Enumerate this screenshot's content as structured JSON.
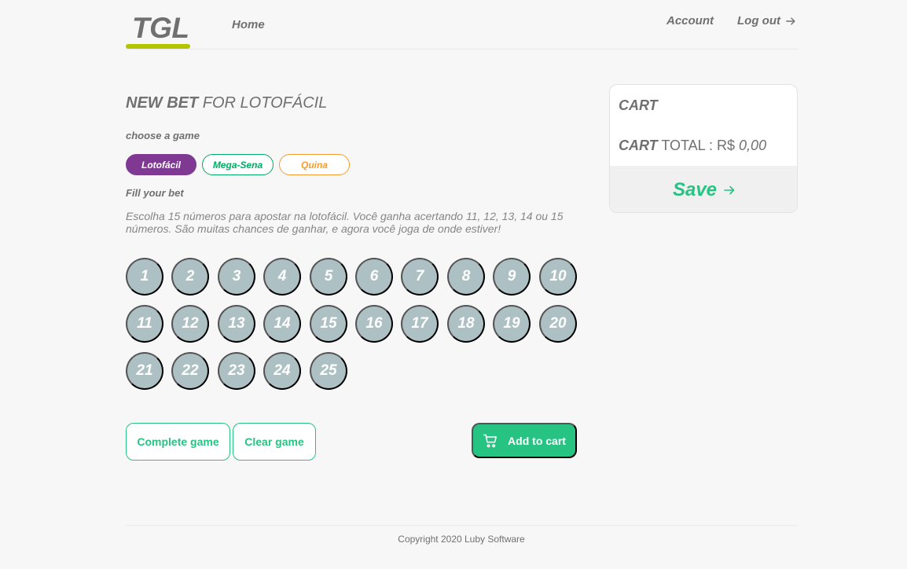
{
  "header": {
    "logo": "TGL",
    "nav_home": "Home",
    "nav_account": "Account",
    "nav_logout": "Log out"
  },
  "main": {
    "title_bold": "NEW BET",
    "title_rest": " FOR LOTOFÁCIL",
    "choose_label": "choose a game",
    "games": [
      {
        "label": "Lotofácil",
        "color": "#7F3992",
        "selected": true
      },
      {
        "label": "Mega-Sena",
        "color": "#01AC66",
        "selected": false
      },
      {
        "label": "Quina",
        "color": "#F79C31",
        "selected": false
      }
    ],
    "fill_label": "Fill your bet",
    "description": "Escolha 15 números para apostar na lotofácil. Você ganha acertando 11, 12, 13, 14 ou 15 números. São muitas chances de ganhar, e agora você joga de onde estiver!",
    "numbers": [
      "1",
      "2",
      "3",
      "4",
      "5",
      "6",
      "7",
      "8",
      "9",
      "10",
      "11",
      "12",
      "13",
      "14",
      "15",
      "16",
      "17",
      "18",
      "19",
      "20",
      "21",
      "22",
      "23",
      "24",
      "25"
    ],
    "complete_label": "Complete game",
    "clear_label": "Clear game",
    "add_label": "Add to cart"
  },
  "cart": {
    "title": "CART",
    "total_bold": "CART",
    "total_label": " TOTAL : R$ ",
    "total_value": "0,00",
    "save_label": "Save"
  },
  "footer": {
    "copyright": "Copyright 2020 Luby Software"
  },
  "colors": {
    "accent": "#27C383",
    "logo_bar": "#B5C401",
    "number_ball": "#ADC0C4"
  }
}
